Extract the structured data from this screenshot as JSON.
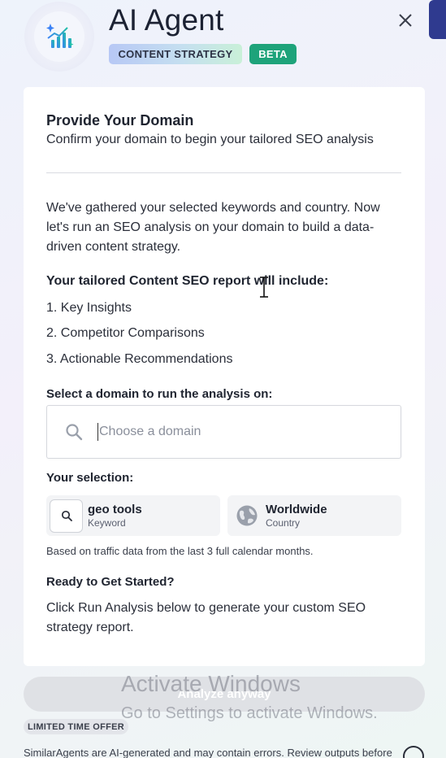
{
  "header": {
    "title": "AI Agent",
    "badge_strategy": "CONTENT STRATEGY",
    "badge_beta": "BETA",
    "logo_icon": "sparkle-chart-icon",
    "close_icon": "close-icon"
  },
  "card": {
    "heading": "Provide Your Domain",
    "subheading": "Confirm your domain to begin your tailored SEO analysis",
    "intro": "We've gathered your selected keywords and country. Now let's run an SEO analysis on your domain to build a data-driven content strategy.",
    "report_heading": "Your tailored Content SEO report will include:",
    "report_items": [
      "1. Key Insights",
      "2. Competitor Comparisons",
      "3. Actionable Recommendations"
    ],
    "domain_label": "Select a domain to run the analysis on:",
    "domain_placeholder": "Choose a domain",
    "selection_label": "Your selection:",
    "selection": {
      "keyword": {
        "value": "geo tools",
        "label": "Keyword"
      },
      "country": {
        "value": "Worldwide",
        "label": "Country"
      }
    },
    "traffic_note": "Based on traffic data from the last 3 full calendar months.",
    "ready_heading": "Ready to Get Started?",
    "ready_text": "Click Run Analysis below to generate your custom SEO strategy report."
  },
  "footer": {
    "analyze_button": "Analyze anyway",
    "offer_badge": "LIMITED TIME OFFER",
    "disclaimer": "SimilarAgents are AI-generated and may contain errors. Review outputs before"
  },
  "watermark": {
    "line1": "Activate Windows",
    "line2": "Go to Settings to activate Windows."
  },
  "colors": {
    "beta_green": "#1ea37a",
    "side_tab_blue": "#2f3a8f"
  }
}
